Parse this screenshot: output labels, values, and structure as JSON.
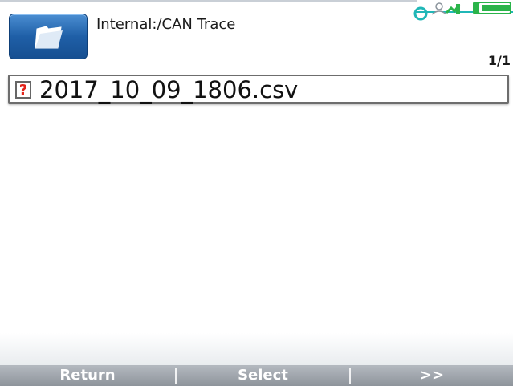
{
  "header": {
    "path": "Internal:/CAN Trace",
    "page_count": "1/1",
    "folder_icon": "folder-icon",
    "status_icons": [
      "connection-icon",
      "signal-icon",
      "battery-icon"
    ]
  },
  "files": [
    {
      "name": "2017_10_09_1806.csv",
      "icon": "unknown-file-icon",
      "icon_text": "?"
    }
  ],
  "softkeys": {
    "left": "Return",
    "middle": "Select",
    "right": ">>"
  },
  "colors": {
    "accent_blue": "#1f5fa7",
    "status_teal": "#20b7b7",
    "battery_green": "#2bb44a",
    "footer_gray": "#9aa0a7"
  }
}
